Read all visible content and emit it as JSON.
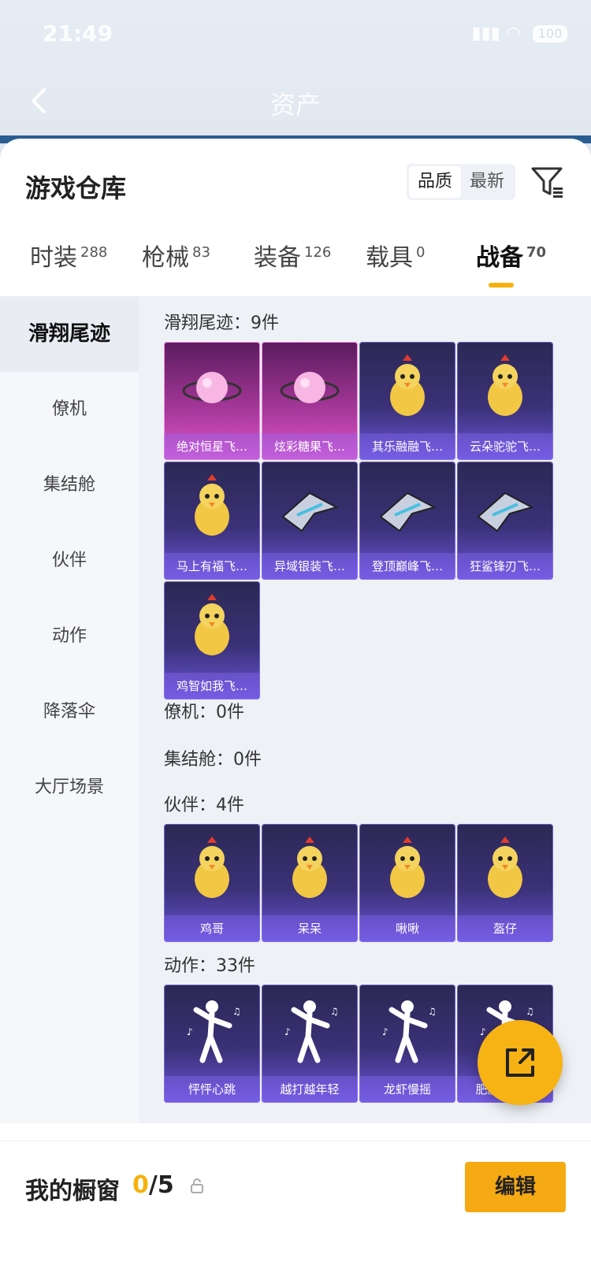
{
  "status_bar": {
    "time": "21:49",
    "battery": "100"
  },
  "header": {
    "title": "资产"
  },
  "warehouse": {
    "title": "游戏仓库",
    "sort_options": [
      "品质",
      "最新"
    ],
    "active_sort": "品质"
  },
  "tabs": [
    {
      "label": "时装",
      "count": "288"
    },
    {
      "label": "枪械",
      "count": "83"
    },
    {
      "label": "装备",
      "count": "126"
    },
    {
      "label": "载具",
      "count": "0"
    },
    {
      "label": "战备",
      "count": "70",
      "active": true
    }
  ],
  "sidebar": {
    "items": [
      {
        "label": "滑翔尾迹",
        "active": true
      },
      {
        "label": "僚机"
      },
      {
        "label": "集结舱"
      },
      {
        "label": "伙伴"
      },
      {
        "label": "动作"
      },
      {
        "label": "降落伞"
      },
      {
        "label": "大厅场景"
      }
    ]
  },
  "sections": [
    {
      "title": "滑翔尾迹：9件",
      "items": [
        {
          "name": "绝对恒星飞…",
          "rarity": "pink",
          "icon": "planet-icon"
        },
        {
          "name": "炫彩糖果飞…",
          "rarity": "pink",
          "icon": "candy-icon"
        },
        {
          "name": "其乐融融飞…",
          "rarity": "purple",
          "icon": "penguin-icon"
        },
        {
          "name": "云朵驼驼飞…",
          "rarity": "purple",
          "icon": "alpaca-icon"
        },
        {
          "name": "马上有福飞…",
          "rarity": "purple",
          "icon": "horse-icon"
        },
        {
          "name": "异域银装飞…",
          "rarity": "purple",
          "icon": "wing-icon"
        },
        {
          "name": "登顶巅峰飞…",
          "rarity": "purple",
          "icon": "jet-icon"
        },
        {
          "name": "狂鲨锋刃飞…",
          "rarity": "purple",
          "icon": "shark-icon"
        },
        {
          "name": "鸡智如我飞…",
          "rarity": "purple",
          "icon": "chicken-icon"
        }
      ]
    },
    {
      "title": "僚机：0件",
      "items": []
    },
    {
      "title": "集结舱：0件",
      "items": []
    },
    {
      "title": "伙伴：4件",
      "items": [
        {
          "name": "鸡哥",
          "icon": "chicken-icon"
        },
        {
          "name": "呆呆",
          "icon": "chick-icon"
        },
        {
          "name": "啾啾",
          "icon": "bird-icon"
        },
        {
          "name": "盔仔",
          "icon": "helmet-chick-icon"
        }
      ]
    },
    {
      "title": "动作：33件",
      "items": [
        {
          "name": "怦怦心跳",
          "icon": "dance-icon"
        },
        {
          "name": "越打越年轻",
          "icon": "dance-icon"
        },
        {
          "name": "龙虾慢摇",
          "icon": "dance-icon"
        },
        {
          "name": "肥肥撒离舞",
          "icon": "dance-icon"
        }
      ]
    }
  ],
  "showcase": {
    "label": "我的橱窗",
    "current": "0",
    "total": "/5"
  },
  "buttons": {
    "edit": "编辑"
  },
  "colors": {
    "accent": "#f5b10c",
    "edit_button": "#f5a913",
    "card_purple": "#3b3178",
    "card_pink": "#a9399c"
  }
}
